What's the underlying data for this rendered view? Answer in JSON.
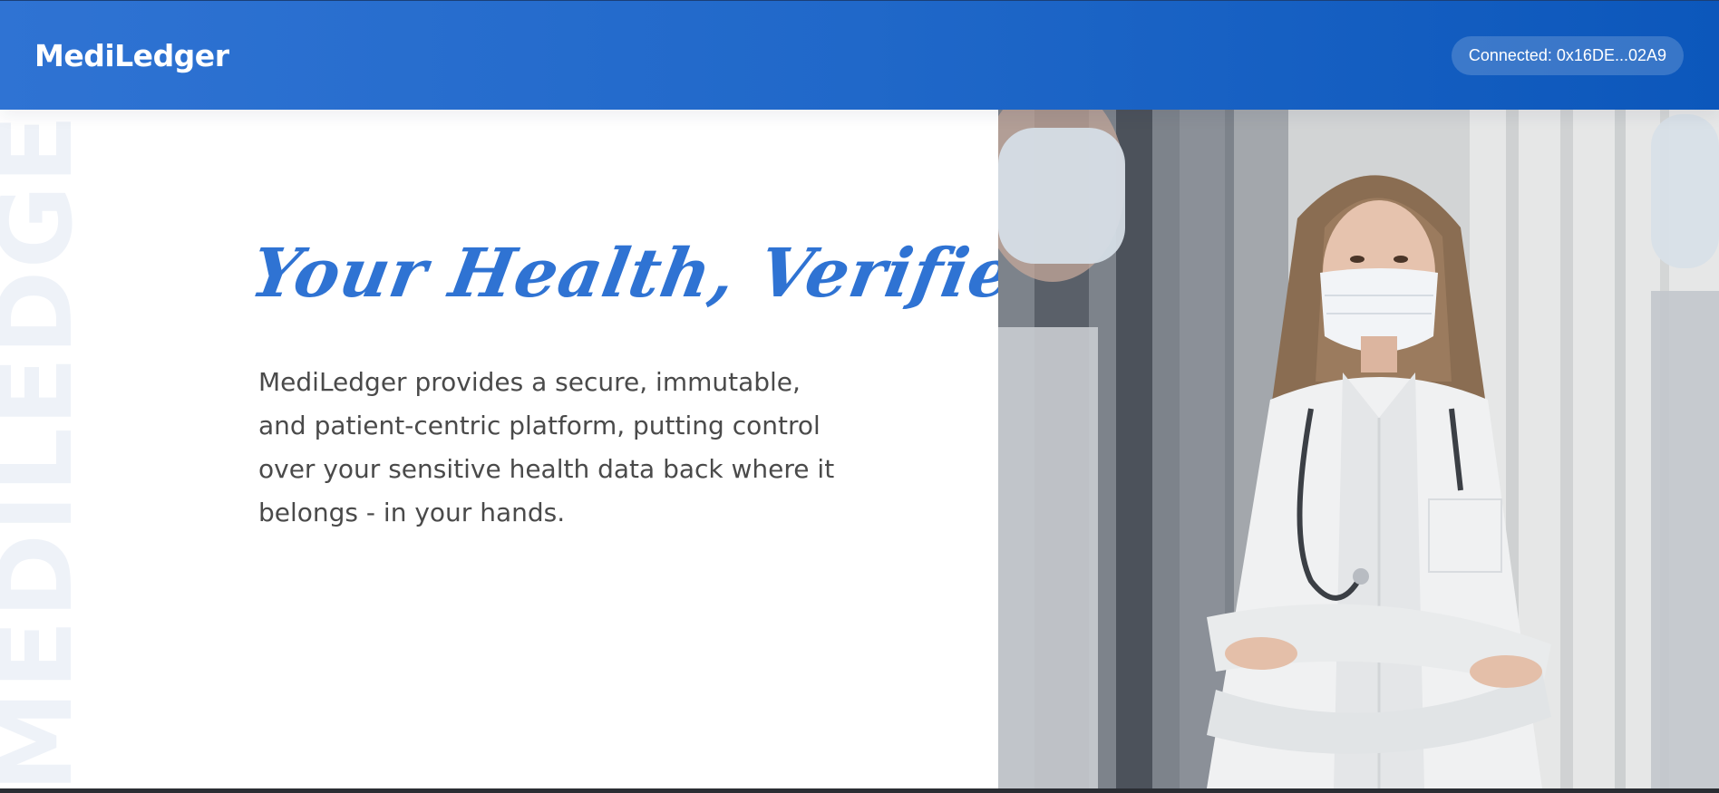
{
  "header": {
    "brand": "MediLedger",
    "wallet_status": "Connected: 0x16DE...02A9"
  },
  "hero": {
    "watermark": "MEDILEDGER",
    "title": "Your Health, Verified.",
    "description": "MediLedger provides a secure, immutable, and patient-centric platform, putting control over your sensitive health data back where it belongs - in your hands.",
    "image_subject": "doctor-in-mask-photo"
  },
  "colors": {
    "header_start": "#2f73d3",
    "header_end": "#0c57bb",
    "title": "#2f73d3",
    "body_text": "#4a4a4a",
    "watermark": "#eef2f8"
  }
}
